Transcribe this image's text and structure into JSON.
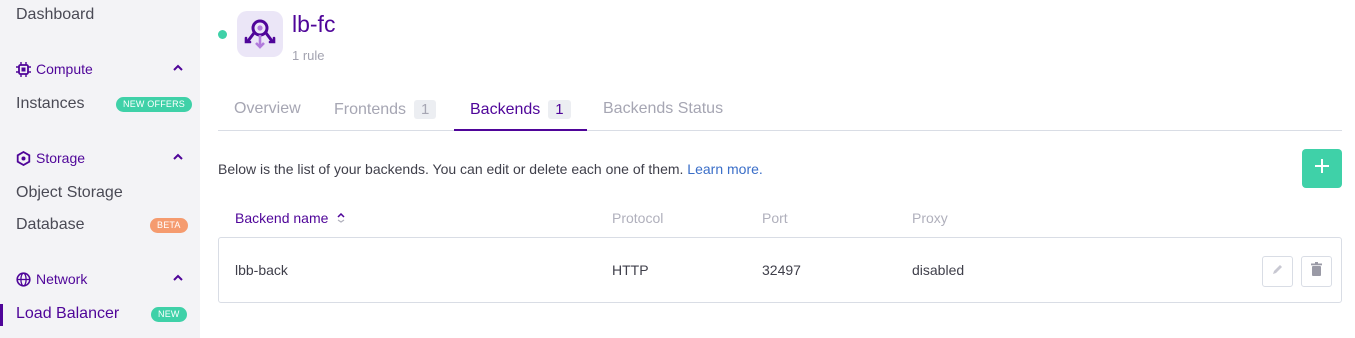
{
  "sidebar": {
    "dashboard": "Dashboard",
    "compute": {
      "label": "Compute",
      "icon": "cpu-icon",
      "items": [
        {
          "label": "Instances",
          "badge": "NEW OFFERS"
        }
      ]
    },
    "storage": {
      "label": "Storage",
      "icon": "storage-icon",
      "items": [
        {
          "label": "Object Storage"
        },
        {
          "label": "Database",
          "badge": "BETA"
        }
      ]
    },
    "network": {
      "label": "Network",
      "icon": "globe-icon",
      "items": [
        {
          "label": "Load Balancer",
          "badge": "NEW"
        }
      ]
    }
  },
  "header": {
    "title": "lb-fc",
    "subtitle": "1 rule",
    "status_color": "#3fd1a8",
    "icon": "load-balancer-icon"
  },
  "tabs": [
    {
      "label": "Overview",
      "count": ""
    },
    {
      "label": "Frontends",
      "count": "1"
    },
    {
      "label": "Backends",
      "count": "1",
      "active": true
    },
    {
      "label": "Backends Status",
      "count": ""
    }
  ],
  "description": {
    "text": "Below is the list of your backends. You can edit or delete each one of them.",
    "link": "Learn more."
  },
  "table": {
    "headers": [
      "Backend name",
      "Protocol",
      "Port",
      "Proxy"
    ],
    "rows": [
      {
        "name": "lbb-back",
        "protocol": "HTTP",
        "port": "32497",
        "proxy": "disabled"
      }
    ]
  },
  "colors": {
    "accent": "#4f0599",
    "green": "#3fd1a8",
    "orange": "#f59b6f",
    "link": "#3a6ec8"
  }
}
